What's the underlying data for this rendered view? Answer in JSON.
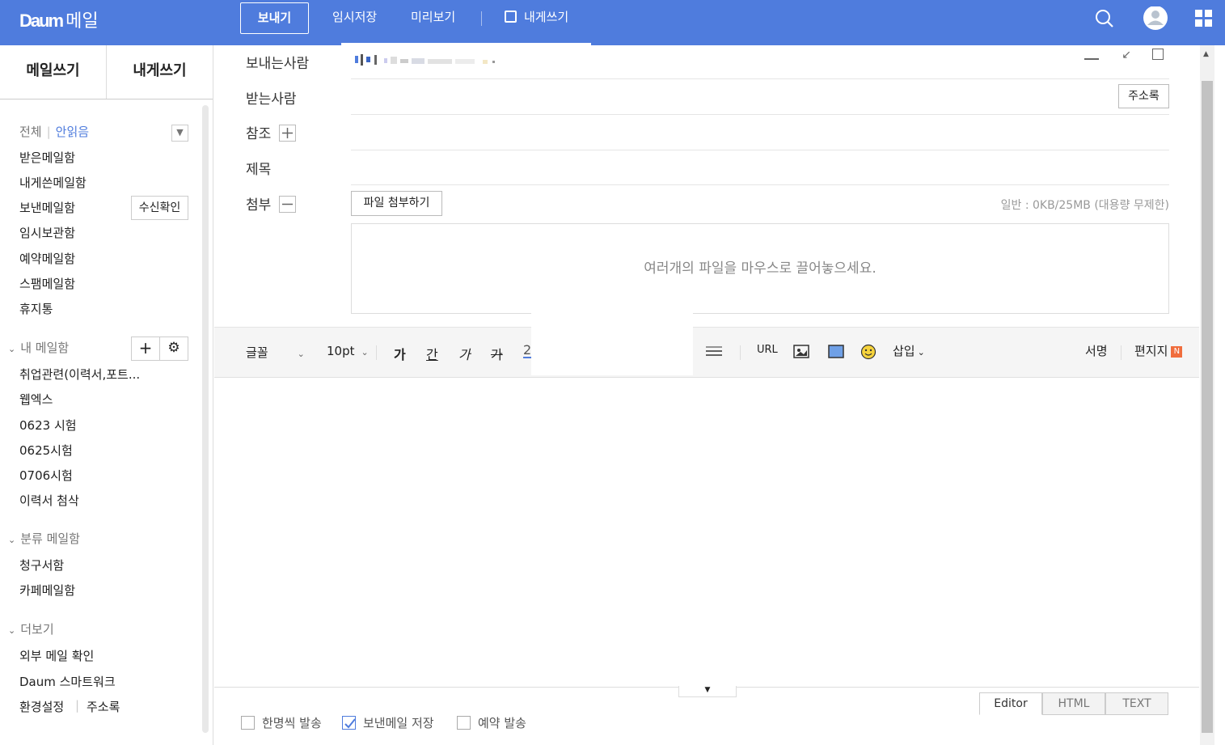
{
  "app": {
    "brand": "Daum",
    "service": "메일"
  },
  "toolbar": {
    "send": "보내기",
    "save_draft": "임시저장",
    "preview": "미리보기",
    "write_to_self": "내게쓰기"
  },
  "sidebar": {
    "tabs": [
      "메일쓰기",
      "내게쓰기"
    ],
    "filter_all": "전체",
    "filter_unread": "안읽음",
    "read_receipt": "수신확인",
    "mailboxes": [
      "받은메일함",
      "내게쓴메일함",
      "보낸메일함",
      "임시보관함",
      "예약메일함",
      "스팸메일함",
      "휴지통"
    ],
    "my_mailbox_title": "내 메일함",
    "my_mailboxes": [
      "취업관련(이력서,포트...",
      "웹엑스",
      "0623 시험",
      "0625시험",
      "0706시험",
      "이력서 첨삭"
    ],
    "category_title": "분류 메일함",
    "category_mailboxes": [
      "청구서함",
      "카페메일함"
    ],
    "more_title": "더보기",
    "more_items": [
      "외부 메일 확인",
      "Daum 스마트워크"
    ],
    "settings": "환경설정",
    "address_book": "주소록"
  },
  "compose": {
    "from_label": "보내는사람",
    "to_label": "받는사람",
    "to_value": "",
    "address_book_btn": "주소록",
    "cc_label": "참조",
    "subject_label": "제목",
    "subject_value": "",
    "attach_label": "첨부",
    "attach_btn": "파일 첨부하기",
    "quota": "일반 : 0KB/25MB (대용량 무제한)",
    "dropzone": "여러개의 파일을 마우스로 끌어놓으세요."
  },
  "editor": {
    "font": "글꼴",
    "size": "10pt",
    "bold": "가",
    "underline": "간",
    "italic": "가",
    "strike": "가",
    "color": "2",
    "url": "URL",
    "insert": "삽입",
    "signature": "서명",
    "stationery": "편지지",
    "new_badge": "N"
  },
  "bottom": {
    "send_individually": "한명씩 발송",
    "save_sent": "보낸메일 저장",
    "schedule": "예약 발송",
    "modes": [
      "Editor",
      "HTML",
      "TEXT"
    ]
  },
  "colors": {
    "accent": "#4f7cdd",
    "new_badge": "#f06d3d"
  }
}
